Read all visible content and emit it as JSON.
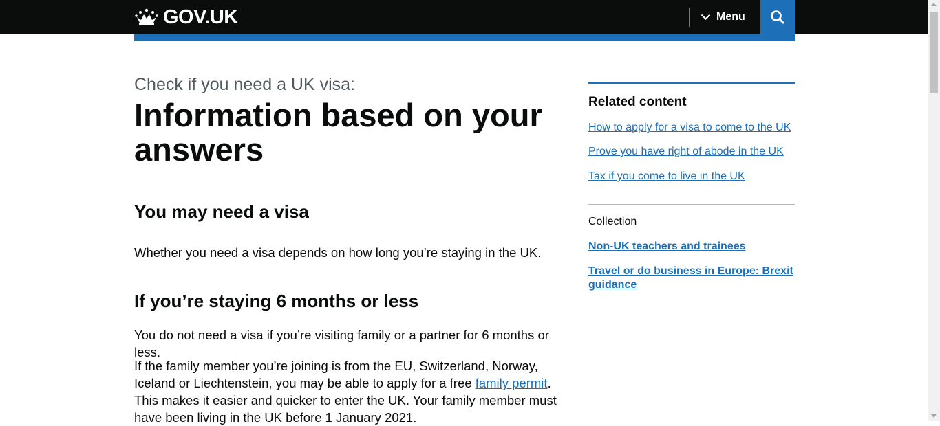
{
  "header": {
    "logo_text": "GOV.UK",
    "menu_label": "Menu",
    "colors": {
      "header_bg": "#0b0c0c",
      "accent": "#1d70b8"
    }
  },
  "main": {
    "caption": "Check if you need a UK visa:",
    "title": "Information based on your answers",
    "section1": {
      "heading": "You may need a visa",
      "body": "Whether you need a visa depends on how long you’re staying in the UK."
    },
    "section2": {
      "heading": "If you’re staying 6 months or less",
      "para1": "You do not need a visa if you’re visiting family or a partner for 6 months or less.",
      "para2_before": "If the family member you’re joining is from the EU, Switzerland, Norway, Iceland or Liechtenstein, you may be able to apply for a free ",
      "para2_link": "family permit",
      "para2_after": ". This makes it easier and quicker to enter the UK. Your family member must have been living in the UK before 1 January 2021."
    }
  },
  "sidebar": {
    "heading": "Related content",
    "links": [
      "How to apply for a visa to come to the UK",
      "Prove you have right of abode in the UK",
      "Tax if you come to live in the UK"
    ],
    "collection_label": "Collection",
    "collection_links": [
      "Non-UK teachers and trainees",
      "Travel or do business in Europe: Brexit guidance"
    ]
  }
}
